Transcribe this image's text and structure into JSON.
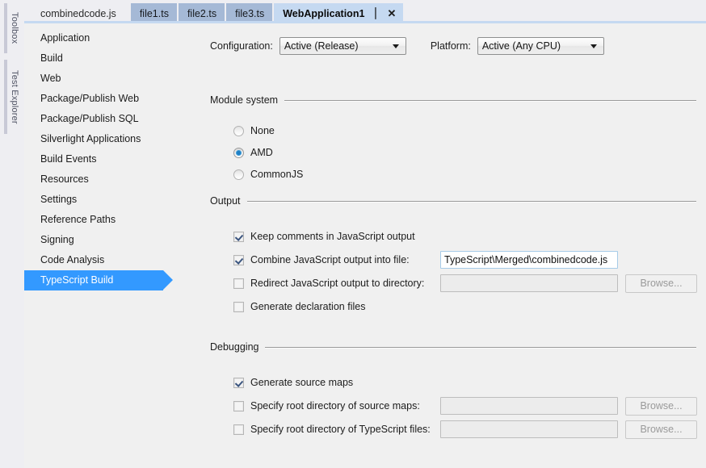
{
  "dock": {
    "tabs": [
      {
        "label": "Toolbox"
      },
      {
        "label": "Test Explorer"
      }
    ]
  },
  "tab_bar": {
    "tabs": [
      {
        "label": "combinedcode.js",
        "state": "inactive-light"
      },
      {
        "label": "file1.ts",
        "state": "inactive"
      },
      {
        "label": "file2.ts",
        "state": "inactive"
      },
      {
        "label": "file3.ts",
        "state": "inactive"
      },
      {
        "label": "WebApplication1",
        "state": "active"
      }
    ],
    "pin_icon": "⏐",
    "close_icon": "✕"
  },
  "categories": {
    "items": [
      {
        "label": "Application",
        "selected": false
      },
      {
        "label": "Build",
        "selected": false
      },
      {
        "label": "Web",
        "selected": false
      },
      {
        "label": "Package/Publish Web",
        "selected": false
      },
      {
        "label": "Package/Publish SQL",
        "selected": false
      },
      {
        "label": "Silverlight Applications",
        "selected": false
      },
      {
        "label": "Build Events",
        "selected": false
      },
      {
        "label": "Resources",
        "selected": false
      },
      {
        "label": "Settings",
        "selected": false
      },
      {
        "label": "Reference Paths",
        "selected": false
      },
      {
        "label": "Signing",
        "selected": false
      },
      {
        "label": "Code Analysis",
        "selected": false
      },
      {
        "label": "TypeScript Build",
        "selected": true
      }
    ],
    "selected_accent": "#3399ff"
  },
  "config_row": {
    "configuration_label": "Configuration:",
    "configuration_value": "Active (Release)",
    "platform_label": "Platform:",
    "platform_value": "Active (Any CPU)"
  },
  "module_system": {
    "title": "Module system",
    "options": [
      {
        "label": "None",
        "checked": false
      },
      {
        "label": "AMD",
        "checked": true
      },
      {
        "label": "CommonJS",
        "checked": false
      }
    ]
  },
  "output": {
    "title": "Output",
    "keep_comments": {
      "label": "Keep comments in JavaScript output",
      "checked": true
    },
    "combine_file": {
      "label": "Combine JavaScript output into file:",
      "checked": true,
      "value": "TypeScript\\Merged\\combinedcode.js",
      "enabled": true
    },
    "redirect_dir": {
      "label": "Redirect JavaScript output to directory:",
      "checked": false,
      "value": "",
      "enabled": false,
      "browse_label": "Browse..."
    },
    "generate_declaration": {
      "label": "Generate declaration files",
      "checked": false
    }
  },
  "debugging": {
    "title": "Debugging",
    "generate_source_maps": {
      "label": "Generate source maps",
      "checked": true
    },
    "source_map_root": {
      "label": "Specify root directory of source maps:",
      "checked": false,
      "value": "",
      "enabled": false,
      "browse_label": "Browse..."
    },
    "typescript_root": {
      "label": "Specify root directory of TypeScript files:",
      "checked": false,
      "value": "",
      "enabled": false,
      "browse_label": "Browse..."
    }
  }
}
